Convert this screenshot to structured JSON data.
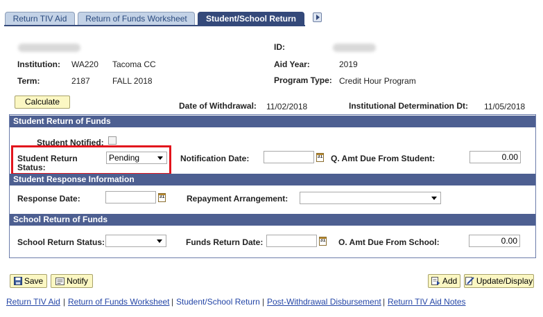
{
  "tabs": [
    {
      "label": "Return TIV Aid"
    },
    {
      "label": "Return of Funds Worksheet"
    },
    {
      "label": "Student/School Return"
    }
  ],
  "header": {
    "id_label": "ID:",
    "institution_label": "Institution:",
    "institution_code": "WA220",
    "institution_name": "Tacoma CC",
    "term_label": "Term:",
    "term_code": "2187",
    "term_name": "FALL 2018",
    "aid_year_label": "Aid Year:",
    "aid_year": "2019",
    "program_type_label": "Program Type:",
    "program_type": "Credit Hour Program"
  },
  "calc": {
    "button": "Calculate",
    "withdrawal_label": "Date of Withdrawal:",
    "withdrawal_date": "11/02/2018",
    "inst_det_label": "Institutional Determination Dt:",
    "inst_det_date": "11/05/2018"
  },
  "student_return": {
    "header": "Student Return of Funds",
    "notified_label": "Student Notified:",
    "status_label_1": "Student Return",
    "status_label_2": "Status:",
    "status_value": "Pending",
    "notification_label": "Notification Date:",
    "notification_value": "",
    "amt_label": "Q. Amt Due From Student:",
    "amt_value": "0.00"
  },
  "student_response": {
    "header": "Student Response Information",
    "response_label": "Response Date:",
    "response_value": "",
    "repayment_label": "Repayment Arrangement:",
    "repayment_value": ""
  },
  "school_return": {
    "header": "School Return of Funds",
    "status_label": "School Return Status:",
    "status_value": "",
    "funds_date_label": "Funds Return Date:",
    "funds_date_value": "",
    "amt_label": "O. Amt Due From School:",
    "amt_value": "0.00"
  },
  "toolbar": {
    "save": "Save",
    "notify": "Notify",
    "add": "Add",
    "update": "Update/Display"
  },
  "footer_links": {
    "l1": "Return TIV Aid",
    "l2": "Return of Funds Worksheet",
    "l3": "Student/School Return",
    "l4": "Post-Withdrawal Disbursement",
    "l5": "Return TIV Aid Notes",
    "sep": "|"
  },
  "calendar_glyph": "31"
}
